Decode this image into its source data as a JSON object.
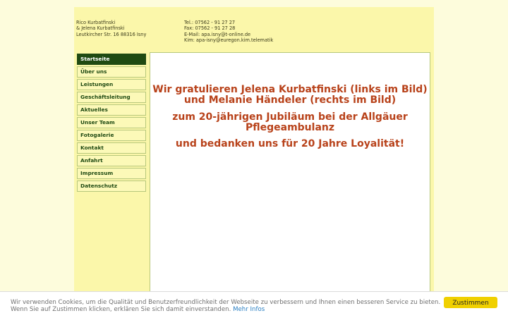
{
  "header": {
    "owner_lines": [
      "Rico Kurbatfinski",
      "& Jelena Kurbatfinski",
      "Leutkircher Str. 16  88316 Isny"
    ],
    "contact_lines": [
      "Tel.: 07562 - 91 27 27",
      "Fax: 07562 - 91 27 28",
      "E-Mail: apa.isny@t-online.de",
      "Kim: apa-isny@euregon.kim.telematik"
    ]
  },
  "nav": {
    "items": [
      {
        "label": "Startseite",
        "active": true
      },
      {
        "label": "Über uns"
      },
      {
        "label": "Leistungen"
      },
      {
        "label": "Geschäftsleitung"
      },
      {
        "label": "Aktuelles"
      },
      {
        "label": "Unser Team"
      },
      {
        "label": "Fotogalerie"
      },
      {
        "label": "Kontakt"
      },
      {
        "label": "Anfahrt"
      },
      {
        "label": "Impressum"
      },
      {
        "label": "Datenschutz"
      }
    ]
  },
  "main": {
    "message_1": "Wir gratulieren Jelena Kurbatfinski (links im Bild) und Melanie Händeler (rechts im Bild)",
    "message_2": "zum 20-jährigen Jubiläum bei der Allgäuer Pflegeambulanz",
    "message_3": "und bedanken uns für 20 Jahre Loyalität!"
  },
  "cookie": {
    "text": "Wir verwenden Cookies, um die Qualität und Benutzerfreundlichkeit der Webseite zu verbessern und Ihnen einen besseren Service zu bieten. Wenn Sie auf Zustimmen klicken, erklären Sie sich damit einverstanden.",
    "link_label": "Mehr Infos",
    "accept_label": "Zustimmen"
  },
  "colors": {
    "background": "#fdfcdc",
    "page": "#fbf7aa",
    "nav_active": "#1f4a12",
    "message_text": "#b8421a",
    "cookie_button": "#f0d000"
  }
}
